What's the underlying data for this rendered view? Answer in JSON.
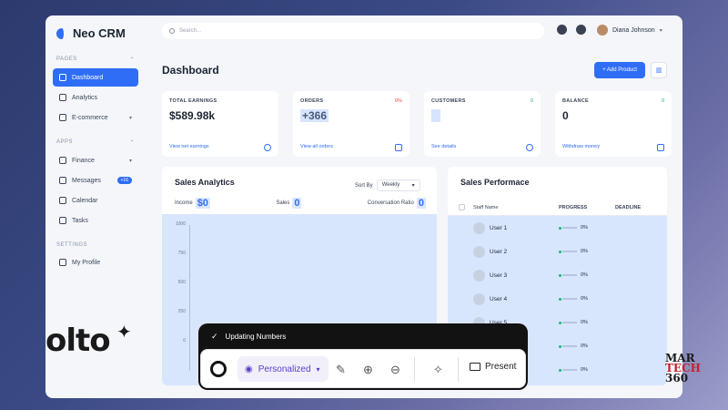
{
  "brand": {
    "name": "Neo CRM",
    "color": "#2f6df6"
  },
  "search": {
    "placeholder": "Search..."
  },
  "user": {
    "name": "Diana Johnson"
  },
  "sidebar": {
    "pages_title": "PAGES",
    "apps_title": "APPS",
    "settings_title": "SETTINGS",
    "pages": [
      {
        "label": "Dashboard",
        "icon": "grid-icon",
        "active": true
      },
      {
        "label": "Analytics",
        "icon": "chart-icon"
      },
      {
        "label": "E-commerce",
        "icon": "cart-icon"
      }
    ],
    "apps": [
      {
        "label": "Finance",
        "icon": "wallet-icon"
      },
      {
        "label": "Messages",
        "icon": "chat-icon",
        "badge": "+16"
      },
      {
        "label": "Calendar",
        "icon": "calendar-icon"
      },
      {
        "label": "Tasks",
        "icon": "tasks-icon"
      }
    ],
    "settings": [
      {
        "label": "My Profile",
        "icon": "user-icon"
      }
    ]
  },
  "header": {
    "title": "Dashboard",
    "add_button": "+ Add Product"
  },
  "cards": [
    {
      "label": "TOTAL EARNINGS",
      "value": "$589.98k",
      "pct": "",
      "link": "View net earnings"
    },
    {
      "label": "ORDERS",
      "value": "+366",
      "pct": "0%",
      "link": "View all orders"
    },
    {
      "label": "CUSTOMERS",
      "value": "",
      "pct": "0",
      "link": "See details"
    },
    {
      "label": "BALANCE",
      "value": "0",
      "pct": "0",
      "link": "Withdraw money"
    }
  ],
  "sales_analytics": {
    "title": "Sales Analytics",
    "sort_label": "Sort By",
    "sort_value": "Weekly",
    "income_label": "Income",
    "income_value": "$0",
    "sales_label": "Sales",
    "sales_value": "0",
    "conv_label": "Conversation Ratio",
    "conv_value": "0",
    "ticks": [
      "1000",
      "750",
      "500",
      "250",
      "0"
    ]
  },
  "sales_performance": {
    "title": "Sales Performace",
    "col_staff": "Staff Name",
    "col_progress": "PROGRESS",
    "col_deadline": "DEADLINE",
    "rows": [
      {
        "name": "User 1",
        "progress": "0%"
      },
      {
        "name": "User 2",
        "progress": "0%"
      },
      {
        "name": "User 3",
        "progress": "0%"
      },
      {
        "name": "User 4",
        "progress": "0%"
      },
      {
        "name": "User 5",
        "progress": "0%"
      },
      {
        "name": "",
        "progress": "0%"
      },
      {
        "name": "",
        "progress": "0%"
      }
    ]
  },
  "toolbar": {
    "status": "Updating Numbers",
    "mode": "Personalized",
    "present": "Present"
  },
  "overlay": {
    "olto": "olto",
    "martech": "MAR",
    "martech2": "TECH",
    "martech3": "360"
  }
}
